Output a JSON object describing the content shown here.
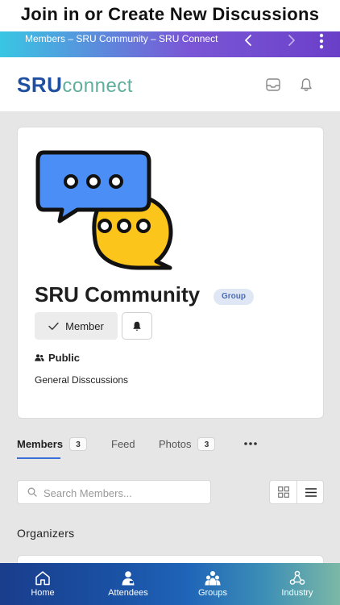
{
  "promo": {
    "text": "Join in or Create New Discussions"
  },
  "browser": {
    "title": "Members – SRU Community – SRU Connect",
    "icons": [
      "chevron-left-icon",
      "chevron-right-icon",
      "more-vertical-icon"
    ]
  },
  "header": {
    "logo_primary": "SRU",
    "logo_secondary": "connect",
    "icons": [
      "inbox-icon",
      "bell-icon"
    ]
  },
  "group": {
    "title": "SRU Community",
    "badge": "Group",
    "member_label": "Member",
    "privacy": "Public",
    "description": "General Disscussions"
  },
  "tabs": [
    {
      "label": "Members",
      "count": "3",
      "active": true
    },
    {
      "label": "Feed",
      "count": null,
      "active": false
    },
    {
      "label": "Photos",
      "count": "3",
      "active": false
    }
  ],
  "search": {
    "placeholder": "Search Members..."
  },
  "section": {
    "heading": "Organizers"
  },
  "bottom_nav": [
    {
      "label": "Home",
      "icon": "home-icon"
    },
    {
      "label": "Attendees",
      "icon": "user-badge-icon"
    },
    {
      "label": "Groups",
      "icon": "group-icon"
    },
    {
      "label": "Industry",
      "icon": "network-icon"
    }
  ],
  "colors": {
    "brand_blue": "#1f4fa0",
    "brand_teal": "#5faf9c",
    "tab_active": "#3a6fd8",
    "bubble_blue": "#4b8ef5",
    "bubble_yellow": "#fbc51b"
  }
}
